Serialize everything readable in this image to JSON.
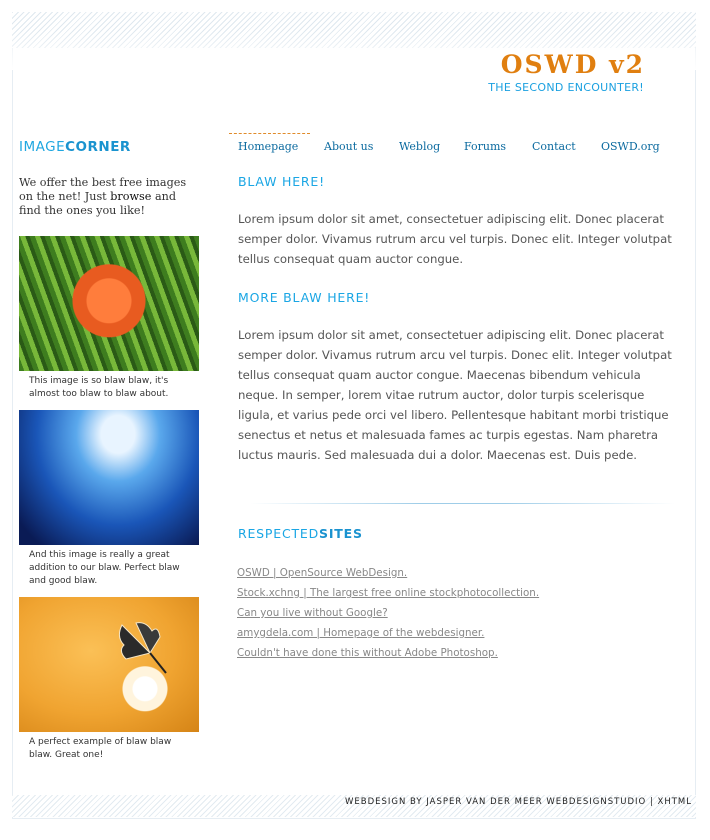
{
  "header": {
    "title": "OSWD v2",
    "subtitle": "THE SECOND ENCOUNTER!"
  },
  "sidebar": {
    "title_light": "IMAGE",
    "title_bold": "CORNER",
    "intro_before": "We offer the best free images on the net! Just ",
    "intro_link": "browse",
    "intro_after": " and find the ones you like!",
    "images": [
      {
        "icon": "orange-lily-photo",
        "caption": "This image is so blaw blaw, it's almost too blaw to blaw about."
      },
      {
        "icon": "underwater-light-photo",
        "caption": "And this image is really a great addition to our blaw. Perfect blaw and good blaw."
      },
      {
        "icon": "butterfly-on-flower-photo",
        "caption": "A perfect example of blaw blaw blaw. Great one!"
      }
    ]
  },
  "nav": {
    "items": [
      "Homepage",
      "About us",
      "Weblog",
      "Forums",
      "Contact",
      "OSWD.org"
    ],
    "active": "Homepage"
  },
  "main": {
    "section1_title": "BLAW HERE!",
    "section1_text": "Lorem ipsum dolor sit amet, consectetuer adipiscing elit. Donec placerat semper dolor. Vivamus rutrum arcu vel turpis. Donec elit. Integer volutpat tellus consequat quam auctor congue.",
    "section2_title": "MORE BLAW HERE!",
    "section2_text": "Lorem ipsum dolor sit amet, consectetuer adipiscing elit. Donec placerat semper dolor. Vivamus rutrum arcu vel turpis. Donec elit. Integer volutpat tellus consequat quam auctor congue. Maecenas bibendum vehicula neque. In semper, lorem vitae rutrum auctor, dolor turpis scelerisque ligula, et varius pede orci vel libero. Pellentesque habitant morbi tristique senectus et netus et malesuada fames ac turpis egestas. Nam pharetra luctus mauris. Sed malesuada dui a dolor. Maecenas est. Duis pede.",
    "sites_title_light": "RESPECTED",
    "sites_title_bold": "SITES",
    "sites": [
      "OSWD | OpenSource WebDesign.",
      "Stock.xchng | The largest free online stockphotocollection.",
      "Can you live without Google?",
      "amygdela.com | Homepage of the webdesigner.",
      "Couldn't have done this without Adobe Photoshop."
    ]
  },
  "footer": {
    "text": "WEBDESIGN BY JASPER VAN DER MEER WEBDESIGNSTUDIO | XHTML"
  },
  "colors": {
    "accent_orange": "#e07f10",
    "accent_blue": "#1aa0e0",
    "nav_link": "#0b6a9f"
  }
}
